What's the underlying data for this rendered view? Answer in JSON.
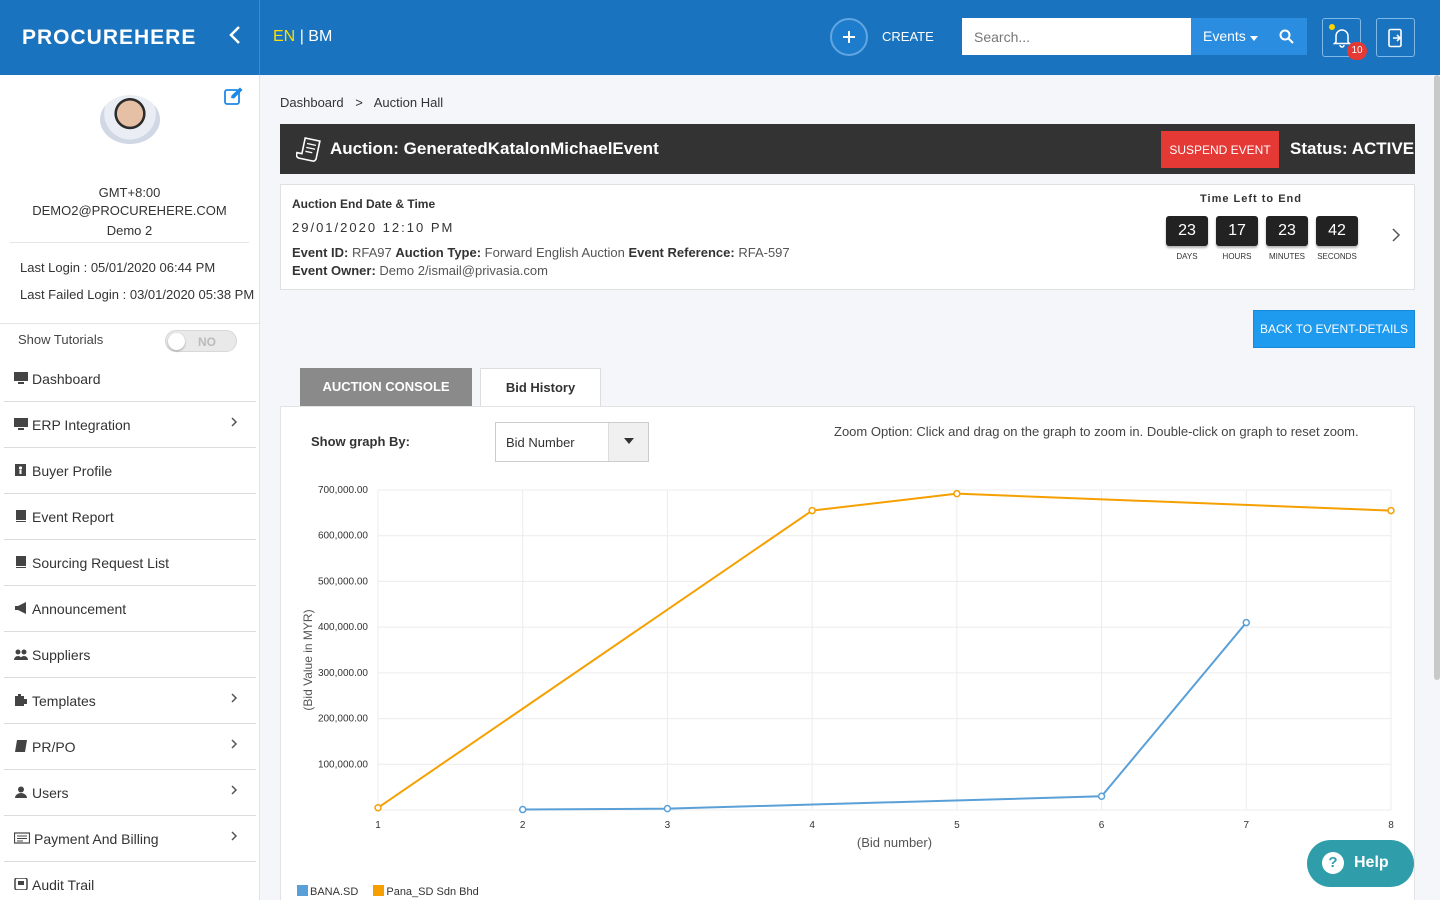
{
  "header": {
    "logo": "PROCUREHERE",
    "lang_en": "EN",
    "lang_sep": "|",
    "lang_bm": "BM",
    "create_label": "CREATE",
    "search_placeholder": "Search...",
    "events_dropdown": "Events",
    "notification_count": "10"
  },
  "sidebar": {
    "timezone": "GMT+8:00",
    "email": "DEMO2@PROCUREHERE.COM",
    "name": "Demo 2",
    "last_login": "Last Login : 05/01/2020 06:44 PM",
    "last_failed_login": "Last Failed Login : 03/01/2020 05:38 PM",
    "tutorials_label": "Show Tutorials",
    "tutorials_state": "NO",
    "items": [
      {
        "label": "Dashboard",
        "icon": "desktop-icon",
        "chevron": false
      },
      {
        "label": "ERP Integration",
        "icon": "desktop-icon",
        "chevron": true
      },
      {
        "label": "Buyer Profile",
        "icon": "id-card-icon",
        "chevron": false
      },
      {
        "label": "Event Report",
        "icon": "book-icon",
        "chevron": false
      },
      {
        "label": "Sourcing Request List",
        "icon": "book-icon",
        "chevron": false
      },
      {
        "label": "Announcement",
        "icon": "megaphone-icon",
        "chevron": false
      },
      {
        "label": "Suppliers",
        "icon": "users-icon",
        "chevron": false
      },
      {
        "label": "Templates",
        "icon": "template-icon",
        "chevron": true
      },
      {
        "label": "PR/PO",
        "icon": "document-icon",
        "chevron": true
      },
      {
        "label": "Users",
        "icon": "user-icon",
        "chevron": true
      },
      {
        "label": "Payment And Billing",
        "icon": "billing-icon",
        "chevron": true
      },
      {
        "label": "Audit Trail",
        "icon": "audit-icon",
        "chevron": false
      }
    ]
  },
  "breadcrumb": {
    "root": "Dashboard",
    "sep": ">",
    "current": "Auction Hall"
  },
  "auction": {
    "title": "Auction: GeneratedKatalonMichaelEvent",
    "suspend_label": "SUSPEND EVENT",
    "status": "Status: ACTIVE",
    "end_heading": "Auction End Date & Time",
    "end_datetime": "29/01/2020 12:10 PM",
    "event_id_label": "Event ID:",
    "event_id": "RFA97",
    "auction_type_label": "Auction Type:",
    "auction_type": "Forward English Auction",
    "event_ref_label": "Event Reference:",
    "event_ref": "RFA-597",
    "owner_label": "Event Owner:",
    "owner": "Demo 2/ismail@privasia.com",
    "time_left_label": "Time Left to End",
    "countdown": {
      "days": "23",
      "days_label": "DAYS",
      "hours": "17",
      "hours_label": "HOURS",
      "minutes": "23",
      "minutes_label": "MINUTES",
      "seconds": "42",
      "seconds_label": "SECONDS"
    },
    "back_label": "BACK TO EVENT-DETAILS"
  },
  "tabs": {
    "console": "AUCTION CONSOLE",
    "history": "Bid History"
  },
  "graph_controls": {
    "show_by_label": "Show graph By:",
    "show_by_value": "Bid Number",
    "zoom_note": "Zoom Option: Click and drag on the graph to zoom in. Double-click on graph to reset zoom."
  },
  "chart_data": {
    "type": "line",
    "xlabel": "(Bid number)",
    "ylabel": "(Bid Value in MYR)",
    "xlim": [
      1,
      8
    ],
    "ylim": [
      0,
      700000
    ],
    "x_ticks": [
      "1",
      "2",
      "3",
      "4",
      "5",
      "6",
      "7",
      "8"
    ],
    "y_ticks": [
      "100,000.00",
      "200,000.00",
      "300,000.00",
      "400,000.00",
      "500,000.00",
      "600,000.00",
      "700,000.00"
    ],
    "y_tick_values": [
      100000,
      200000,
      300000,
      400000,
      500000,
      600000,
      700000
    ],
    "grid": true,
    "legend_position": "bottom-left",
    "series": [
      {
        "name": "BANA.SD",
        "color": "#5aa0d8",
        "points": [
          [
            2,
            1000
          ],
          [
            3,
            3000
          ],
          [
            6,
            30000
          ],
          [
            7,
            410000
          ]
        ]
      },
      {
        "name": "Pana_SD Sdn Bhd",
        "color": "#f5a000",
        "points": [
          [
            1,
            5000
          ],
          [
            4,
            655000
          ],
          [
            5,
            692000
          ],
          [
            8,
            655000
          ]
        ]
      }
    ]
  },
  "help": {
    "icon_text": "?",
    "label": "Help"
  }
}
